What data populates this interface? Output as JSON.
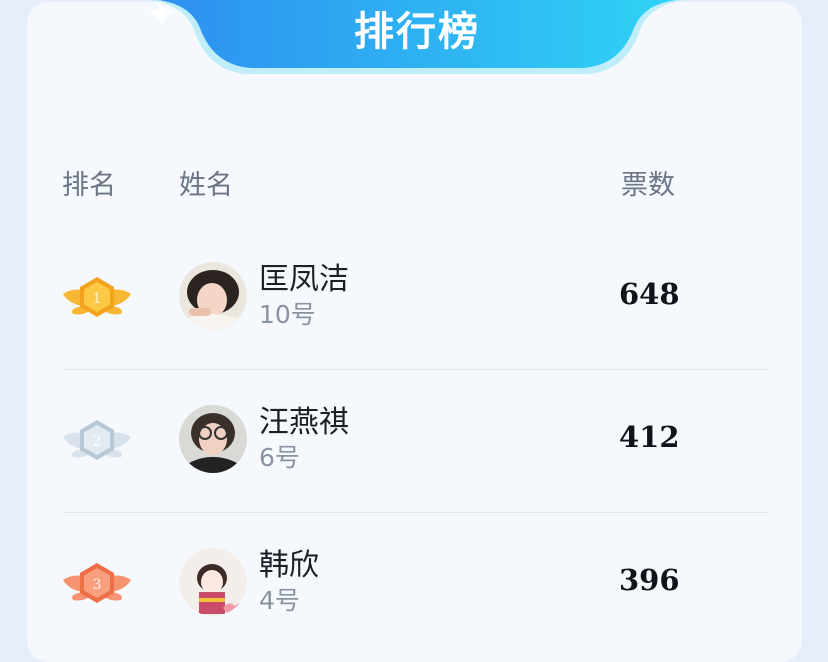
{
  "colors": {
    "banner_start": "#2e8ff0",
    "banner_end": "#2fd3f4",
    "gold": "#f2a21d",
    "silver": "#c6d4e0",
    "bronze": "#f07d55"
  },
  "banner": {
    "title": "排行榜",
    "icon": "sparkle-icon"
  },
  "table": {
    "headers": {
      "rank": "排名",
      "name": "姓名",
      "votes": "票数"
    },
    "rows": [
      {
        "rank": "1",
        "medal": "gold-medal-icon",
        "name": "匡凤洁",
        "number": "10号",
        "votes": "648"
      },
      {
        "rank": "2",
        "medal": "silver-medal-icon",
        "name": "汪燕祺",
        "number": "6号",
        "votes": "412"
      },
      {
        "rank": "3",
        "medal": "bronze-medal-icon",
        "name": "韩欣",
        "number": "4号",
        "votes": "396"
      }
    ]
  }
}
